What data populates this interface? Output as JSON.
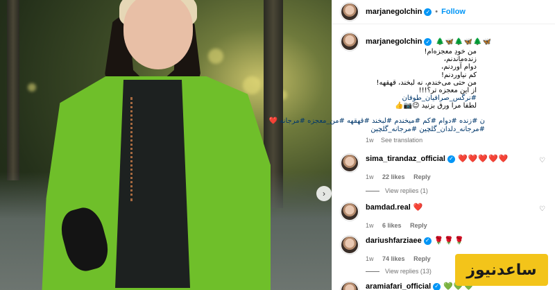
{
  "post": {
    "username": "marjanegolchin",
    "follow_label": "Follow",
    "header_separator": "•"
  },
  "caption": {
    "username": "marjanegolchin",
    "emojis": "🌲🦋🌲🦋🌲🦋",
    "lines": [
      "من خودِ معجزه‌ام!",
      "زنده‌ماندنم،",
      "دوام آوردنم،",
      "کم نیاوردنم!",
      "من حتی می‌خندم، نه لبخند، قهقهه!",
      "از این معجزه تر؟!!!",
      "#نرگس_صرافیان_طوفان",
      "لطفا مرا ورق بزنید 😉📷👍"
    ],
    "hashtags": [
      "ن #زنده #دوام #کم #میخندم #لبخند #قهقهه #من_معجزه #مرجانه ❤️",
      "#مرجانه_دلدان_گلچین #مرجانه_گلچین"
    ],
    "time": "1w",
    "see_translation": "See translation"
  },
  "comments": [
    {
      "username": "sima_tirandaz_official",
      "text": "❤️❤️❤️❤️❤️",
      "time": "1w",
      "likes": "22 likes",
      "reply_label": "Reply",
      "view_replies": "View replies (1)"
    },
    {
      "username": "bamdad.real",
      "text": "❤️",
      "time": "1w",
      "likes": "6 likes",
      "reply_label": "Reply"
    },
    {
      "username": "dariushfarziaee",
      "text": "🌹🌹🌹",
      "time": "1w",
      "likes": "74 likes",
      "reply_label": "Reply",
      "view_replies": "View replies (13)"
    },
    {
      "username": "aramiafari_official",
      "text": "💚💚💚"
    }
  ],
  "watermark": "ساعدنیوز",
  "colors": {
    "accent": "#0095f6",
    "link": "#00376b",
    "heart": "#e0245e",
    "watermark_bg": "#f3c41a",
    "jacket_green": "#6fbf2a"
  },
  "icons": {
    "verified": "verified-badge-icon",
    "carousel_next": "chevron-right-icon",
    "like": "heart-outline-icon"
  }
}
